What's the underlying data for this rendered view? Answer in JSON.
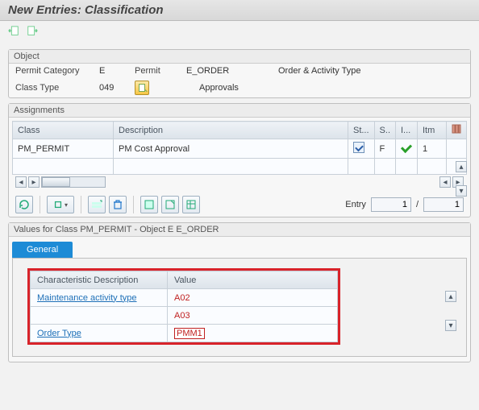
{
  "title": "New Entries: Classification",
  "object": {
    "panel_title": "Object",
    "permit_category_label": "Permit Category",
    "permit_category_value": "E",
    "permit_label": "Permit",
    "permit_value": "E_ORDER",
    "permit_right": "Order  & Activity Type",
    "class_type_label": "Class Type",
    "class_type_value": "049",
    "approvals_label": "Approvals"
  },
  "assignments": {
    "panel_title": "Assignments",
    "col_class": "Class",
    "col_desc": "Description",
    "col_st": "St...",
    "col_s": "S..",
    "col_i": "I...",
    "col_itm": "Itm",
    "rows": [
      {
        "class": "PM_PERMIT",
        "desc": "PM Cost Approval",
        "s": "F",
        "itm": "1"
      }
    ],
    "entry_label": "Entry",
    "entry_value": "1",
    "entry_sep": "/",
    "entry_total": "1"
  },
  "values": {
    "panel_title": "Values for Class PM_PERMIT - Object E E_ORDER",
    "tab_general": "General",
    "col_char": "Characteristic Description",
    "col_value": "Value",
    "rows": [
      {
        "char": "Maintenance activity type",
        "link": true,
        "value": "A02"
      },
      {
        "char": "",
        "link": false,
        "value": "A03"
      },
      {
        "char": "Order Type",
        "link": true,
        "value": "PMM1",
        "boxed": true
      }
    ]
  }
}
